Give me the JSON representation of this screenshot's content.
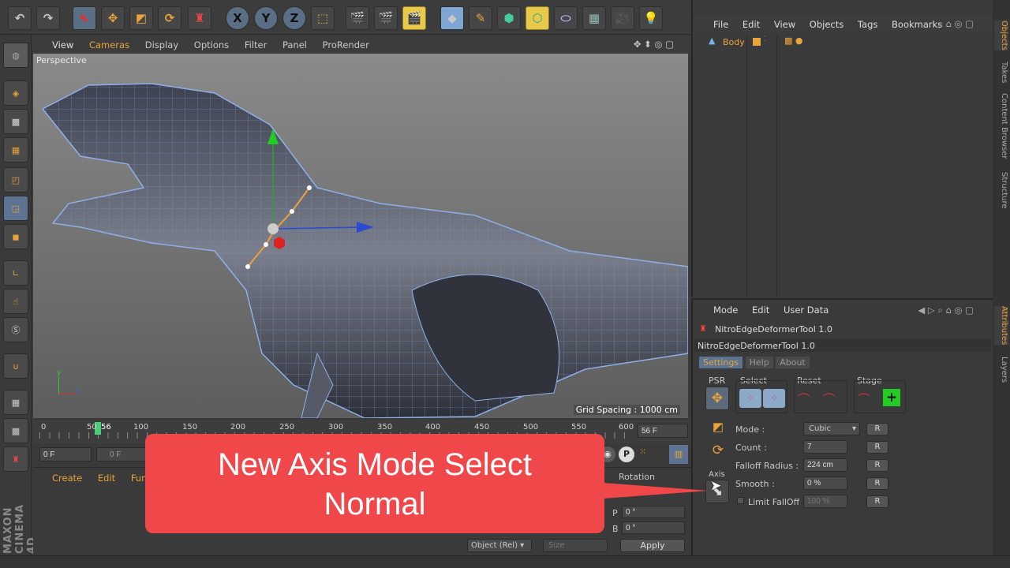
{
  "viewport": {
    "menu": [
      "View",
      "Cameras",
      "Display",
      "Options",
      "Filter",
      "Panel",
      "ProRender"
    ],
    "label": "Perspective",
    "grid_spacing": "Grid Spacing : 1000 cm"
  },
  "toolbar": {
    "axis_x": "X",
    "axis_y": "Y",
    "axis_z": "Z"
  },
  "timeline": {
    "ticks": [
      "0",
      "50",
      "56",
      "100",
      "150",
      "200",
      "250",
      "300",
      "350",
      "400",
      "450",
      "500",
      "550",
      "600"
    ],
    "current_frame": "56 F",
    "start_frame": "0 F",
    "range_start": "0 F"
  },
  "materials": {
    "menu": [
      "Create",
      "Edit",
      "Functio"
    ]
  },
  "coords": {
    "rotation_label": "Rotation",
    "p_label": "P",
    "p_value": "0 °",
    "b_label": "B",
    "b_value": "0 °",
    "mode": "Object (Rel)",
    "size_label": "Size",
    "apply": "Apply"
  },
  "objects": {
    "menu": [
      "File",
      "Edit",
      "View",
      "Objects",
      "Tags",
      "Bookmarks"
    ],
    "item": "Body"
  },
  "side_tabs": {
    "top": [
      "Objects",
      "Takes",
      "Content Browser",
      "Structure"
    ],
    "bottom": [
      "Attributes",
      "Layers"
    ]
  },
  "attributes": {
    "menu": [
      "Mode",
      "Edit",
      "User Data"
    ],
    "tool_name": "NitroEdgeDeformerTool 1.0",
    "tool_name2": "NitroEdgeDeformerTool 1.0",
    "tabs": [
      "Settings",
      "Help",
      "About"
    ],
    "groups": [
      "PSR",
      "Select",
      "Reset",
      "Stage"
    ],
    "axis_label": "Axis",
    "mode_label": "Mode :",
    "mode_value": "Cubic",
    "count_label": "Count :",
    "count_value": "7",
    "falloff_label": "Falloff Radius :",
    "falloff_value": "224 cm",
    "smooth_label": "Smooth :",
    "smooth_value": "0 %",
    "limit_label": "Limit FallOff",
    "limit_value": "100 %",
    "r": "R"
  },
  "banner": {
    "line1": "New Axis Mode Select",
    "line2": "Normal"
  },
  "logo": "MAXON CINEMA 4D",
  "colors": {
    "banner": "#f0474b",
    "accent_orange": "#e8a33a",
    "selection_blue": "#5c7392",
    "panel": "#3a3a3a"
  }
}
